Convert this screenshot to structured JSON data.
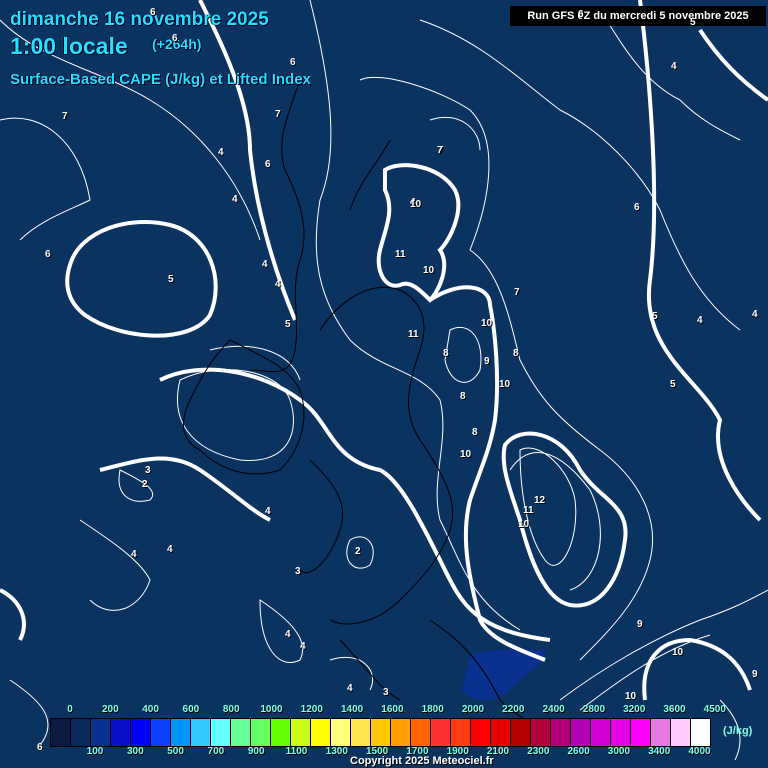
{
  "header": {
    "date": "dimanche 16 novembre 2025",
    "time": "1:00 locale",
    "lead": "(+264h)",
    "parameter": "Surface-Based CAPE (J/kg) et Lifted Index",
    "run": "Run GFS 0Z du mercredi 5 novembre 2025"
  },
  "colorbar": {
    "unit": "(J/kg)",
    "top_ticks": [
      "0",
      "200",
      "400",
      "600",
      "800",
      "1000",
      "1200",
      "1400",
      "1600",
      "1800",
      "2000",
      "2200",
      "2400",
      "2800",
      "3200",
      "3600",
      "4500"
    ],
    "bottom_ticks": [
      "100",
      "300",
      "500",
      "700",
      "900",
      "1100",
      "1300",
      "1500",
      "1700",
      "1900",
      "2100",
      "2300",
      "2600",
      "3000",
      "3400",
      "4000"
    ],
    "colors": [
      "#0a1a40",
      "#0a2a5a",
      "#0a3090",
      "#0a10c8",
      "#0000ff",
      "#0a40ff",
      "#0096ff",
      "#32c8ff",
      "#64ffff",
      "#64ff96",
      "#64ff64",
      "#64ff00",
      "#c8ff14",
      "#ffff00",
      "#ffff80",
      "#ffe650",
      "#ffc800",
      "#ffa000",
      "#ff6400",
      "#ff3232",
      "#ff3c14",
      "#ff0000",
      "#e60000",
      "#b40000",
      "#b4003c",
      "#b40078",
      "#b400b4",
      "#d200d2",
      "#e600e6",
      "#ff00ff",
      "#e678e6",
      "#ffc8ff",
      "#ffffff"
    ]
  },
  "contour_labels": [
    "6",
    "6",
    "7",
    "6",
    "7",
    "6",
    "6",
    "4",
    "4",
    "4",
    "4",
    "4",
    "5",
    "5",
    "7",
    "10",
    "11",
    "10",
    "11",
    "10",
    "8",
    "9",
    "8",
    "10",
    "7",
    "8",
    "8",
    "10",
    "12",
    "11",
    "10",
    "6",
    "5",
    "4",
    "5",
    "4",
    "3",
    "2",
    "4",
    "4",
    "4",
    "2",
    "3",
    "4",
    "4",
    "4",
    "3",
    "6",
    "9",
    "10",
    "9",
    "10",
    "5",
    "4",
    "7",
    "6"
  ],
  "copyright": "Copyright 2025 Meteociel.fr"
}
